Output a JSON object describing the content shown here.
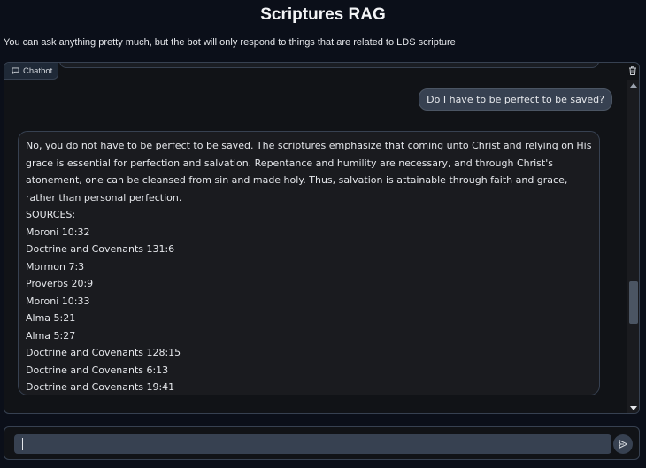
{
  "header": {
    "title": "Scriptures RAG",
    "subtitle": "You can ask anything pretty much, but the bot will only respond to things that are related to LDS scripture"
  },
  "chatbot": {
    "label": "Chatbot",
    "label_icon": "chat-bubble-icon",
    "clear_icon": "trash-icon",
    "messages": {
      "user": "Do I have to be perfect to be saved?",
      "bot_text": "No, you do not have to be perfect to be saved. The scriptures emphasize that coming unto Christ and relying on His grace is essential for perfection and salvation. Repentance and humility are necessary, and through Christ's atonement, one can be cleansed from sin and made holy. Thus, salvation is attainable through faith and grace, rather than personal perfection.",
      "sources_label": "SOURCES:",
      "sources": [
        "Moroni 10:32",
        "Doctrine and Covenants 131:6",
        "Mormon 7:3",
        "Proverbs 20:9",
        "Moroni 10:33",
        "Alma 5:21",
        "Alma 5:27",
        "Doctrine and Covenants 128:15",
        "Doctrine and Covenants 6:13",
        "Doctrine and Covenants 19:41"
      ]
    }
  },
  "input": {
    "value": "",
    "placeholder": "",
    "send_icon": "send-icon"
  },
  "colors": {
    "background": "#0b0f19",
    "panel": "#111317",
    "user_bubble": "#374151",
    "bot_bubble": "#1a1b1f",
    "border": "#374151"
  }
}
